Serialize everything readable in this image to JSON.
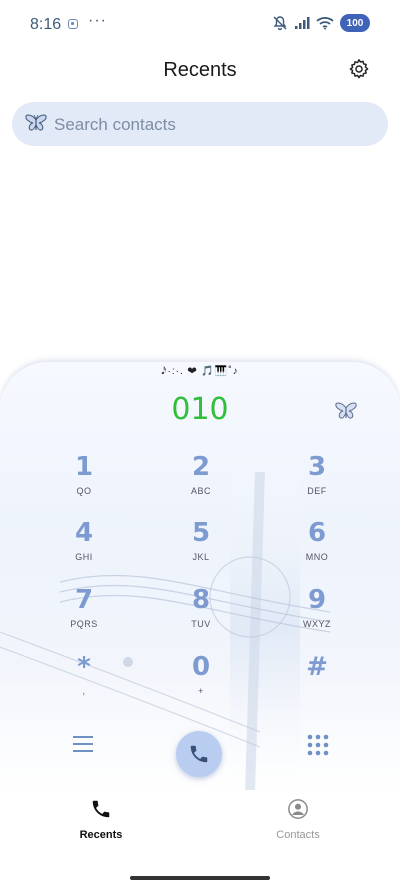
{
  "status_bar": {
    "time": "8:16",
    "more": "···",
    "battery": "100"
  },
  "header": {
    "title": "Recents"
  },
  "search": {
    "placeholder": "Search contacts"
  },
  "dialer": {
    "decoration": "𝅘𝅥𝅯·:·. ❤ 🎵🎹˚♪",
    "number": "010",
    "number_color": "#2fbf3a",
    "keys": [
      {
        "digit": "1",
        "letters": "QO"
      },
      {
        "digit": "2",
        "letters": "ABC"
      },
      {
        "digit": "3",
        "letters": "DEF"
      },
      {
        "digit": "4",
        "letters": "GHI"
      },
      {
        "digit": "5",
        "letters": "JKL"
      },
      {
        "digit": "6",
        "letters": "MNO"
      },
      {
        "digit": "7",
        "letters": "PQRS"
      },
      {
        "digit": "8",
        "letters": "TUV"
      },
      {
        "digit": "9",
        "letters": "WXYZ"
      },
      {
        "digit": "*",
        "letters": ","
      },
      {
        "digit": "0",
        "letters": "+"
      },
      {
        "digit": "#",
        "letters": ""
      }
    ]
  },
  "bottom_nav": {
    "recents_label": "Recents",
    "contacts_label": "Contacts"
  },
  "icons": {
    "search": "butterfly-icon",
    "settings": "gear-icon",
    "call": "phone-icon",
    "menu": "menu-icon",
    "keypad": "keypad-icon",
    "contacts": "person-circle-icon"
  },
  "colors": {
    "accent": "#3f63b8",
    "key_digit": "#7d9bd0",
    "search_bg": "#e2eaf7",
    "call_button": "#b9cdf0"
  }
}
